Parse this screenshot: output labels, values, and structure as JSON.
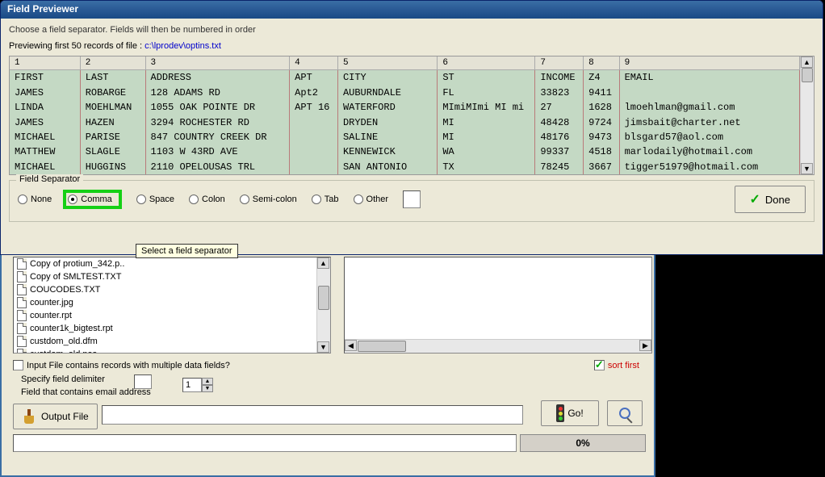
{
  "window": {
    "title": "Field Previewer"
  },
  "instruction": "Choose a field separator. Fields will then be numbered in order",
  "preview": {
    "prefix": "Previewing first 50 records of file :  ",
    "file": "c:\\lprodev\\optins.txt"
  },
  "grid": {
    "headers": [
      "1",
      "2",
      "3",
      "4",
      "5",
      "6",
      "7",
      "8",
      "9"
    ],
    "colWidths": [
      "82px",
      "76px",
      "168px",
      "54px",
      "116px",
      "104px",
      "50px",
      "36px",
      "210px"
    ],
    "rows": [
      [
        "FIRST",
        "LAST",
        "ADDRESS",
        "APT",
        "CITY",
        "ST",
        "INCOME",
        "Z4",
        "EMAIL"
      ],
      [
        "JAMES",
        "ROBARGE",
        "128 ADAMS RD",
        " Apt2",
        "AUBURNDALE",
        "FL",
        "33823",
        "9411",
        ""
      ],
      [
        "LINDA",
        "MOEHLMAN",
        "1055 OAK POINTE DR",
        "APT 16",
        "WATERFORD",
        "MImiMImi MI mi",
        "27",
        "1628",
        "lmoehlman@gmail.com"
      ],
      [
        "JAMES",
        "HAZEN",
        "3294 ROCHESTER RD",
        "",
        "DRYDEN",
        "MI",
        "48428",
        "9724",
        "jimsbait@charter.net"
      ],
      [
        "MICHAEL",
        "PARISE",
        "847 COUNTRY CREEK DR",
        "",
        "SALINE",
        "MI",
        "48176",
        "9473",
        "blsgard57@aol.com"
      ],
      [
        "MATTHEW",
        "SLAGLE",
        "1103 W 43RD AVE",
        "",
        "KENNEWICK",
        "WA",
        "99337",
        "4518",
        "marlodaily@hotmail.com"
      ],
      [
        "MICHAEL",
        "HUGGINS",
        "2110 OPELOUSAS TRL",
        "",
        "SAN ANTONIO",
        "TX",
        "78245",
        "3667",
        "tigger51979@hotmail.com"
      ]
    ]
  },
  "separator": {
    "legend": "Field Separator",
    "options": {
      "none": "None",
      "comma": "Comma",
      "space": "Space",
      "colon": "Colon",
      "semicolon": "Semi-colon",
      "tab": "Tab",
      "other": "Other"
    },
    "selected": "comma"
  },
  "doneLabel": "Done",
  "tooltip": "Select a field separator",
  "fileList": [
    "Copy of protium_342.p..",
    "Copy of SMLTEST.TXT",
    "COUCODES.TXT",
    "counter.jpg",
    "counter.rpt",
    "counter1k_bigtest.rpt",
    "custdom_old.dfm",
    "custdom_old.pas"
  ],
  "lower": {
    "multiFieldLabel": "Input File contains records with multiple data fields?",
    "sortFirst": "sort first",
    "delimLabel": "Specify field delimiter",
    "fieldNumLabel": "Field that contains email address",
    "fieldNumValue": "1",
    "outputFile": "Output File",
    "go": "Go!",
    "pct": "0%"
  }
}
